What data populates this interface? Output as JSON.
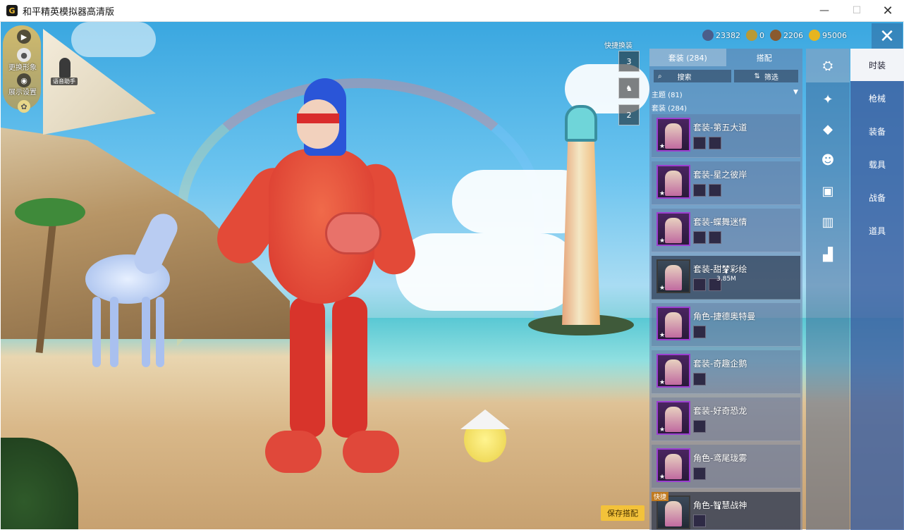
{
  "window": {
    "title": "和平精英模拟器高清版",
    "app_icon_glyph": "G",
    "controls": [
      "—",
      "☐",
      "✕"
    ]
  },
  "left_panel": {
    "items": [
      {
        "label": "",
        "icon": "play-arrow-icon",
        "glyph": "▶"
      },
      {
        "label": "更换形象",
        "icon": "person-icon",
        "glyph": "●"
      },
      {
        "label": "展示设置",
        "icon": "eye-icon",
        "glyph": "◉"
      }
    ],
    "helper_label": "语音助手"
  },
  "currencies": [
    {
      "icon": "diamond-coin-icon",
      "value": "23382",
      "color": "#4b5d8a"
    },
    {
      "icon": "gold-token-icon",
      "value": "0",
      "color": "#b89a35"
    },
    {
      "icon": "bronze-coin-icon",
      "value": "2206",
      "color": "#8a5a2e"
    },
    {
      "icon": "gold-coin-icon",
      "value": "95006",
      "color": "#e6b520"
    }
  ],
  "quick_access": {
    "label": "快捷换装",
    "slots": [
      "3",
      "",
      "2"
    ]
  },
  "panel": {
    "tabs": [
      {
        "label": "套装 (284)",
        "active": true
      },
      {
        "label": "搭配",
        "active": false
      }
    ],
    "search_label": "搜索",
    "filter_label": "筛选",
    "theme_line": "主题 (81)",
    "set_line": "套装 (284)",
    "outfits": [
      {
        "name": "套装-第五大道",
        "minis": 2,
        "selected": false,
        "rarity": "purple"
      },
      {
        "name": "套装-星之彼岸",
        "minis": 2,
        "selected": false,
        "rarity": "purple"
      },
      {
        "name": "套装-蝶舞迷情",
        "minis": 2,
        "selected": false,
        "rarity": "purple"
      },
      {
        "name": "套装-甜梦彩绘",
        "minis": 2,
        "selected": true,
        "rarity": "plain",
        "download": "3.85M"
      },
      {
        "name": "角色-捷德奥特曼",
        "minis": 1,
        "selected": false,
        "rarity": "purple"
      },
      {
        "name": "套装-奇趣企鹅",
        "minis": 1,
        "selected": false,
        "rarity": "purple"
      },
      {
        "name": "套装-好奇恐龙",
        "minis": 1,
        "selected": false,
        "rarity": "purple"
      },
      {
        "name": "角色-鸢尾珑雾",
        "minis": 1,
        "selected": false,
        "rarity": "purple"
      },
      {
        "name": "角色-智慧战神",
        "minis": 1,
        "selected": true,
        "rarity": "plain",
        "download": "",
        "tag": "快捷"
      }
    ]
  },
  "icon_column": [
    {
      "icon": "outfit-hanger-icon",
      "glyph": "⛭",
      "active": true
    },
    {
      "icon": "gun-skin-icon",
      "glyph": "✦",
      "active": false
    },
    {
      "icon": "hat-icon",
      "glyph": "◆",
      "active": false
    },
    {
      "icon": "face-icon",
      "glyph": "☻",
      "active": false
    },
    {
      "icon": "top-icon",
      "glyph": "▣",
      "active": false
    },
    {
      "icon": "pants-icon",
      "glyph": "▥",
      "active": false
    },
    {
      "icon": "shoes-icon",
      "glyph": "▟",
      "active": false
    }
  ],
  "categories": [
    {
      "label": "时装",
      "active": true
    },
    {
      "label": "枪械",
      "active": false
    },
    {
      "label": "装备",
      "active": false
    },
    {
      "label": "载具",
      "active": false
    },
    {
      "label": "战备",
      "active": false
    },
    {
      "label": "道具",
      "active": false
    }
  ],
  "save_button": "保存搭配"
}
